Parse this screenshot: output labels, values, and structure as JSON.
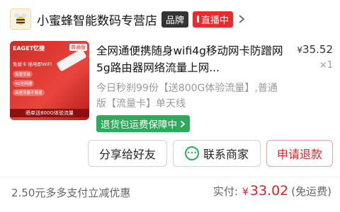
{
  "store": {
    "name": "小蜜蜂智能数码专营店",
    "brand_badge": "品牌",
    "live_badge": "直播中"
  },
  "product": {
    "title": "全网通便携随身wifi4g移动网卡防蹭网5g路由器网络流量上网...",
    "price_symbol": "¥",
    "price": "35.52",
    "quantity": "×1",
    "variant": "今日秒刹99份【送800G体验流量】,普通版【流量卡】单天线",
    "guarantee": "退货包运费保障中",
    "image": {
      "brand": "EAGET忆捷",
      "tag": "普通版",
      "subtitle": "免拔卡·插电即WIFI",
      "features": [
        "免驱安装",
        "4G全网通",
        "高速流量不限速"
      ],
      "bottom": "晒单送800G体验流量"
    }
  },
  "actions": {
    "share": "分享给好友",
    "contact": "联系商家",
    "refund": "申请退款"
  },
  "footer": {
    "discount": "2.50元多多支付立减优惠",
    "paid_label": "实付:",
    "paid_currency": "¥",
    "paid_amount": "33.02",
    "paid_note": "(免运费)"
  },
  "colors": {
    "accent_red": "#e02020",
    "guarantee_green": "#2cab5b",
    "live_red": "#ea2b2b"
  }
}
